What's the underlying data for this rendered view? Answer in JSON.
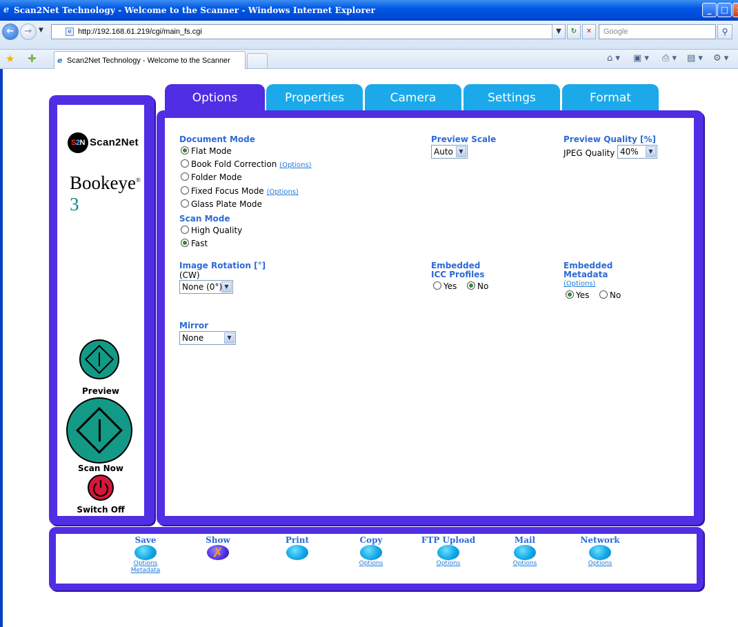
{
  "browser": {
    "window_title": "Scan2Net Technology - Welcome to the Scanner - Windows Internet Explorer",
    "url": "http://192.168.61.219/cgi/main_fs.cgi",
    "search_placeholder": "Google",
    "tab_title": "Scan2Net Technology - Welcome to the Scanner"
  },
  "sidebar": {
    "logo_text": "Scan2Net",
    "logo_badge": "S2N",
    "product_name": "Bookeye",
    "product_version": "3",
    "preview_label": "Preview",
    "scan_label": "Scan Now",
    "switch_off_label": "Switch Off"
  },
  "tabs": [
    "Options",
    "Properties",
    "Camera",
    "Settings",
    "Format"
  ],
  "active_tab": "Options",
  "options": {
    "document_mode_label": "Document Mode",
    "document_modes": [
      {
        "label": "Flat Mode",
        "selected": true,
        "options_link": ""
      },
      {
        "label": "Book Fold Correction",
        "selected": false,
        "options_link": "(Options)"
      },
      {
        "label": "Folder Mode",
        "selected": false,
        "options_link": ""
      },
      {
        "label": "Fixed Focus Mode",
        "selected": false,
        "options_link": "(Options)"
      },
      {
        "label": "Glass Plate Mode",
        "selected": false,
        "options_link": ""
      }
    ],
    "scan_mode_label": "Scan Mode",
    "scan_modes": [
      {
        "label": "High Quality",
        "selected": false
      },
      {
        "label": "Fast",
        "selected": true
      }
    ],
    "preview_scale_label": "Preview Scale",
    "preview_scale_value": "Auto",
    "preview_quality_label": "Preview Quality [%]",
    "jpeg_quality_label": "JPEG Quality",
    "jpeg_quality_value": "40%",
    "image_rotation_label": "Image Rotation [°]",
    "image_rotation_sub": "(CW)",
    "image_rotation_value": "None (0°)",
    "icc_label_1": "Embedded",
    "icc_label_2": "ICC Profiles",
    "icc_yes": "Yes",
    "icc_no": "No",
    "icc_selected": "No",
    "metadata_label_1": "Embedded",
    "metadata_label_2": "Metadata",
    "metadata_options": "(Options)",
    "metadata_yes": "Yes",
    "metadata_no": "No",
    "metadata_selected": "Yes",
    "mirror_label": "Mirror",
    "mirror_value": "None"
  },
  "bottom_bar": [
    {
      "label": "Save",
      "sub": [
        "Options",
        "Metadata"
      ],
      "icon": "cloud-blob"
    },
    {
      "label": "Show",
      "sub": [],
      "icon": "show-x"
    },
    {
      "label": "Print",
      "sub": [],
      "icon": "cloud-blob"
    },
    {
      "label": "Copy",
      "sub": [
        "Options"
      ],
      "icon": "cloud-blob"
    },
    {
      "label": "FTP Upload",
      "sub": [
        "Options"
      ],
      "icon": "cloud-blob"
    },
    {
      "label": "Mail",
      "sub": [
        "Options"
      ],
      "icon": "cloud-blob"
    },
    {
      "label": "Network",
      "sub": [
        "Options"
      ],
      "icon": "cloud-blob"
    }
  ],
  "colors": {
    "panel": "#4f2ee4",
    "tab_inactive": "#1ba9ea",
    "label_blue": "#2c6ad6",
    "action_teal": "#139a86",
    "power_red": "#d5163a"
  }
}
